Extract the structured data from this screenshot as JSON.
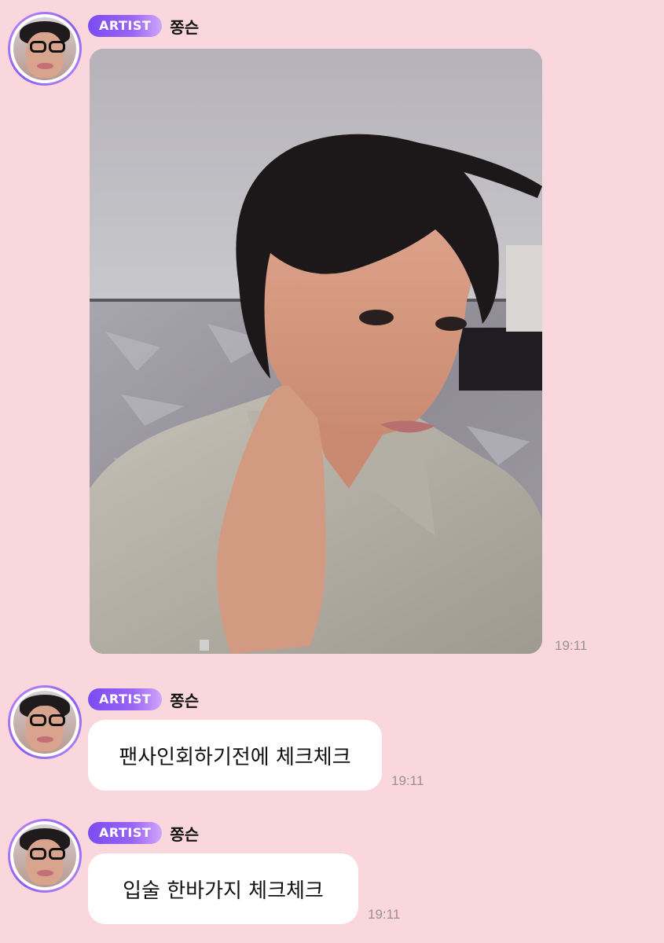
{
  "messages": [
    {
      "badge": "ARTIST",
      "name": "쫑슨",
      "type": "photo",
      "time": "19:11"
    },
    {
      "badge": "ARTIST",
      "name": "쫑슨",
      "type": "text",
      "text": "팬사인회하기전에 체크체크",
      "time": "19:11"
    },
    {
      "badge": "ARTIST",
      "name": "쫑슨",
      "type": "text",
      "text": "입술 한바가지 체크체크",
      "time": "19:11"
    }
  ],
  "colors": {
    "background": "#fad7dd",
    "badge_start": "#7a4cf2",
    "badge_end": "#cfa6fa",
    "bubble": "#ffffff",
    "timestamp": "#9a8f92"
  },
  "icons": {
    "avatar": "artist-avatar-selfie"
  }
}
